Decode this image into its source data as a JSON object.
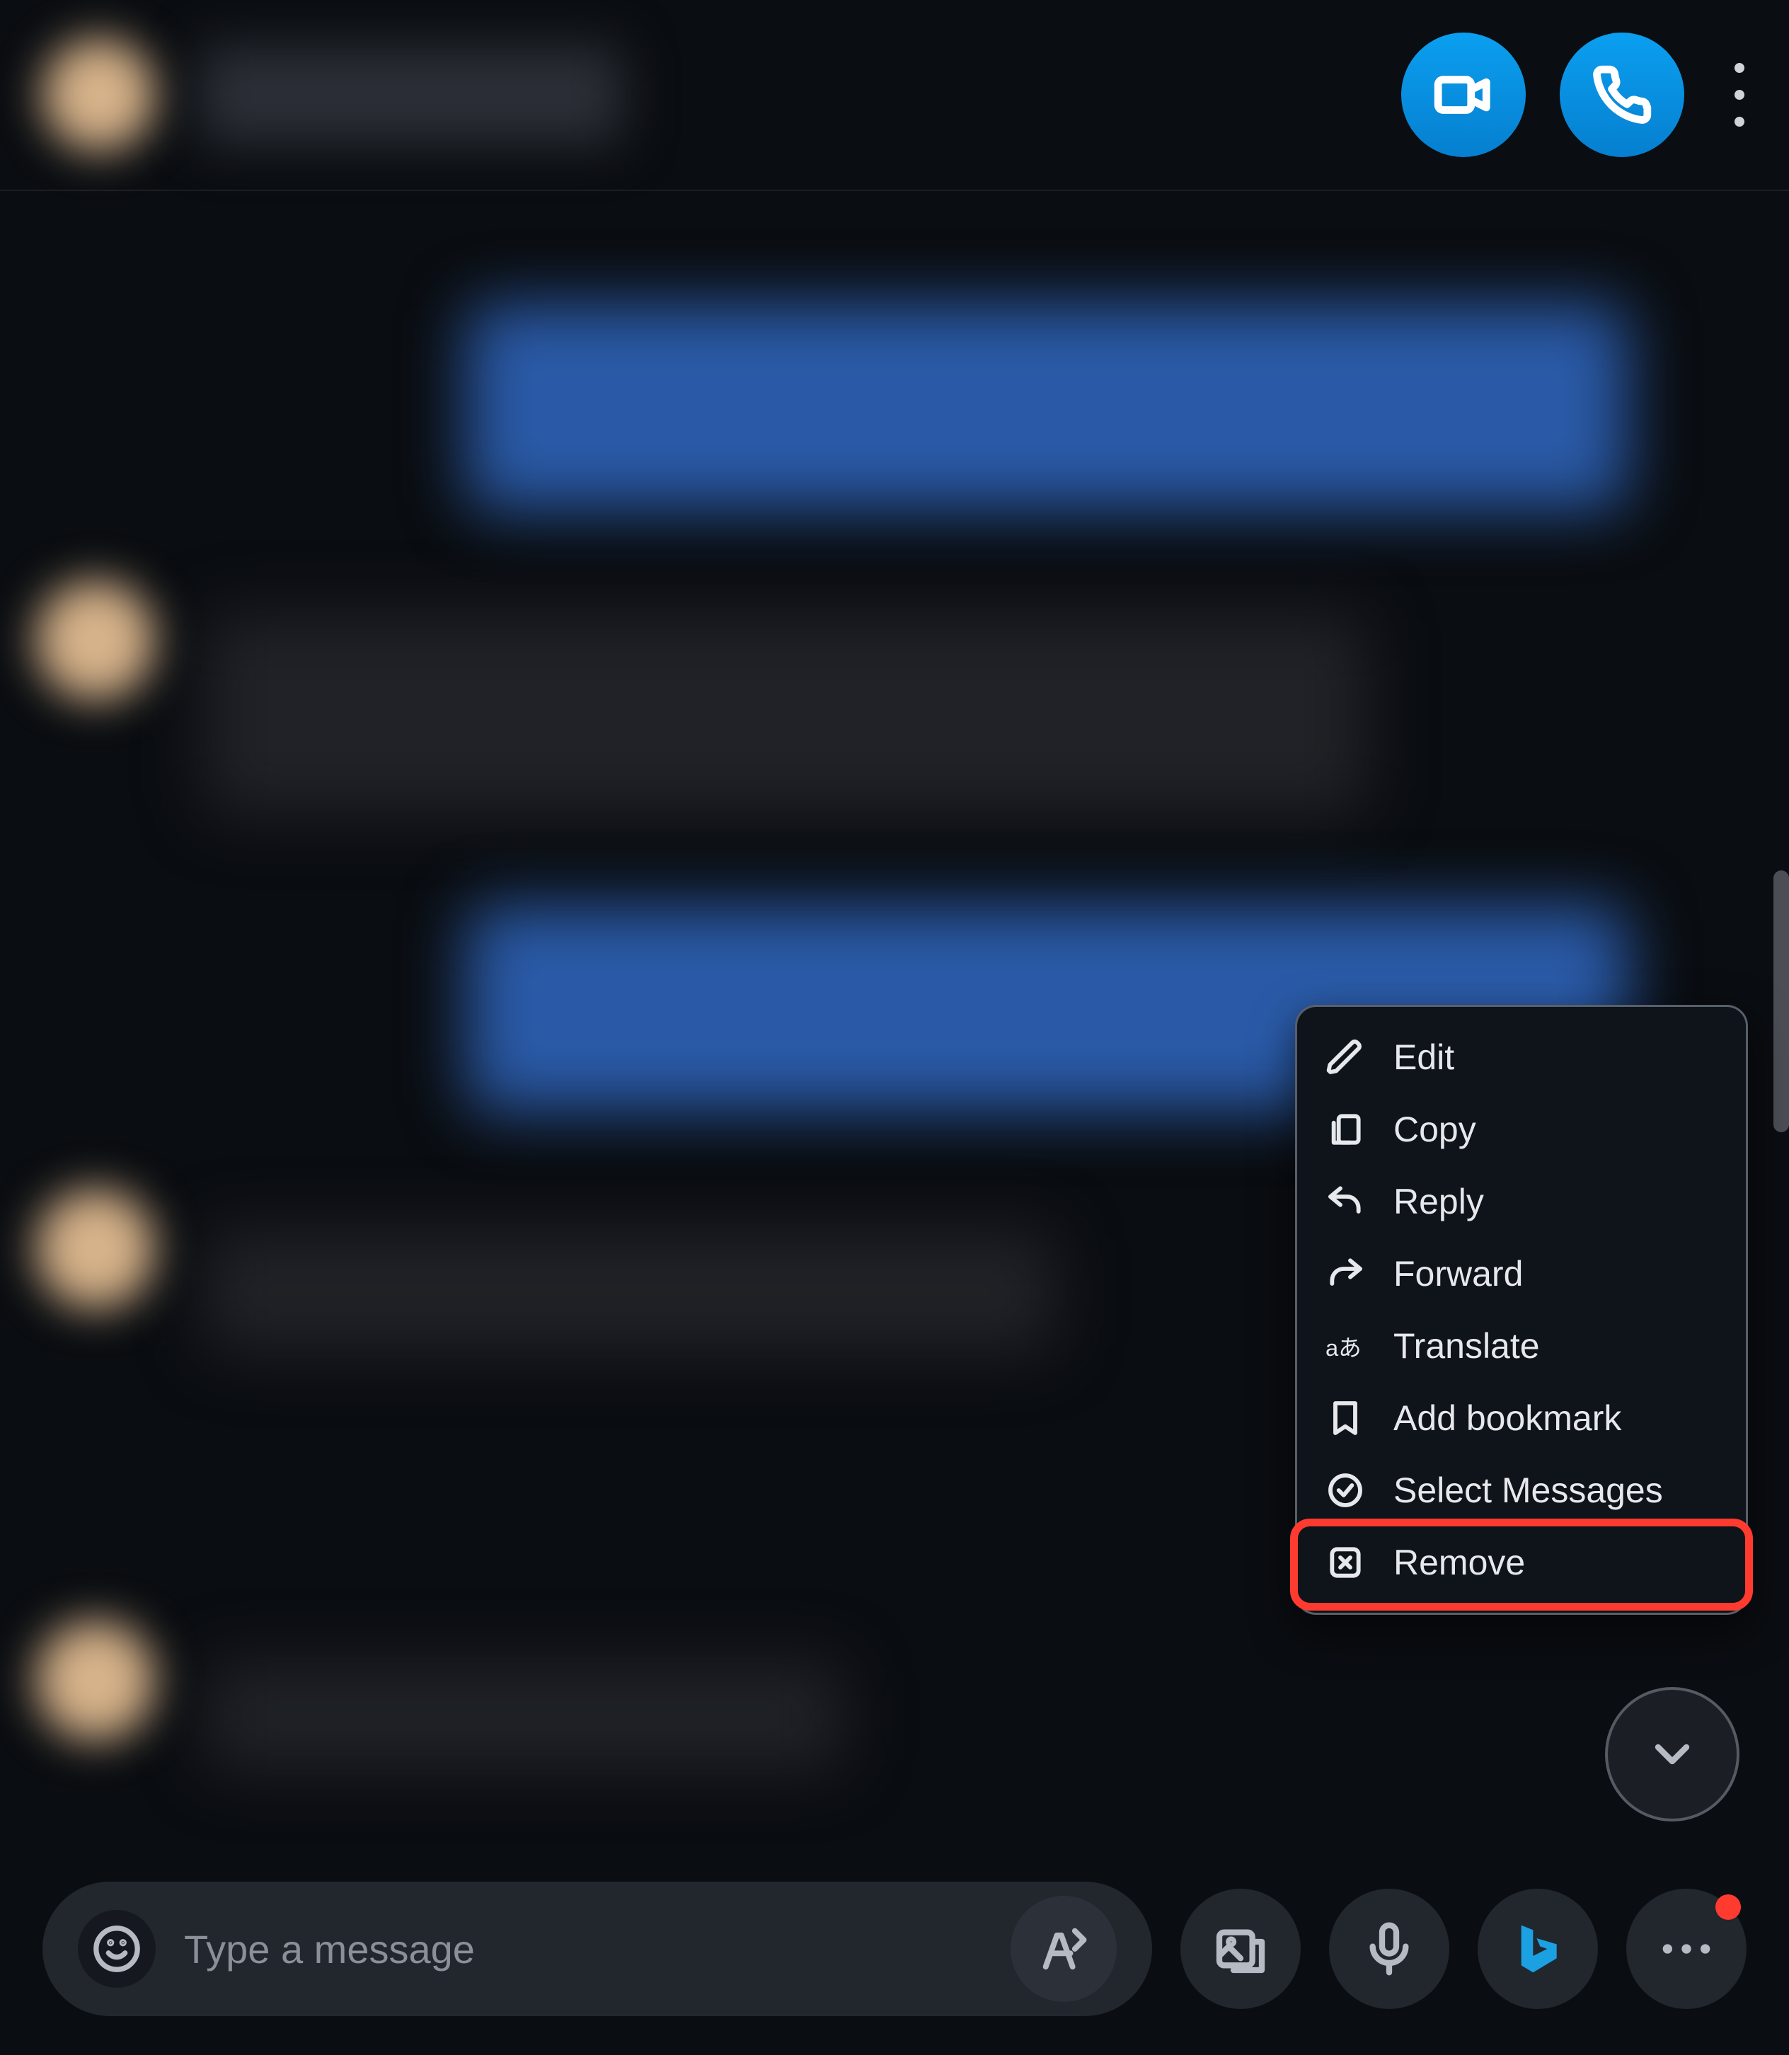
{
  "header": {
    "video_call_tooltip": "Video call",
    "audio_call_tooltip": "Audio call",
    "more_tooltip": "More options"
  },
  "context_menu": {
    "items": [
      {
        "id": "edit-icon",
        "label": "Edit"
      },
      {
        "id": "copy-icon",
        "label": "Copy"
      },
      {
        "id": "reply-icon",
        "label": "Reply"
      },
      {
        "id": "forward-icon",
        "label": "Forward"
      },
      {
        "id": "translate-icon",
        "label": "Translate"
      },
      {
        "id": "bookmark-icon",
        "label": "Add bookmark"
      },
      {
        "id": "select-messages-icon",
        "label": "Select Messages"
      },
      {
        "id": "remove-icon",
        "label": "Remove"
      }
    ],
    "highlighted_index": 7
  },
  "composer": {
    "placeholder": "Type a message"
  },
  "footer_buttons": {
    "emoji_tooltip": "Emoji",
    "format_tooltip": "Format",
    "media_tooltip": "Add files",
    "mic_tooltip": "Voice message",
    "bing_tooltip": "Bing",
    "more_tooltip": "More"
  },
  "scroll_down_tooltip": "Scroll to latest"
}
